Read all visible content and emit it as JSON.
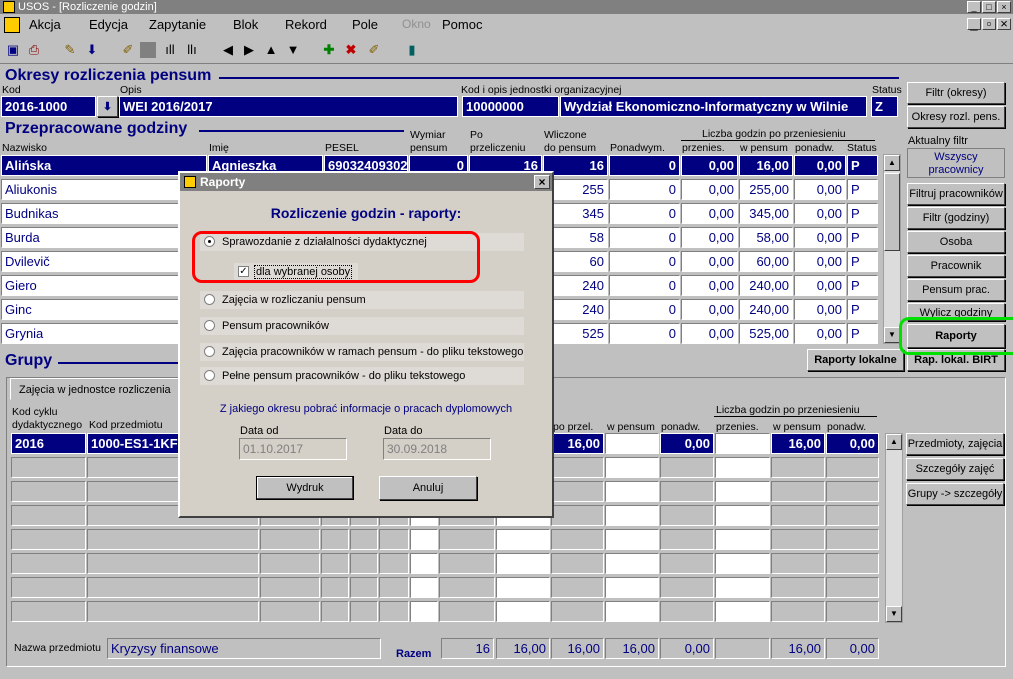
{
  "window": {
    "title": "USOS - [Rozliczenie godzin]"
  },
  "menu": [
    "Akcja",
    "Edycja",
    "Zapytanie",
    "Blok",
    "Rekord",
    "Pole",
    "Okno",
    "Pomoc"
  ],
  "okresy": {
    "title": "Okresy rozliczenia pensum",
    "kod_label": "Kod",
    "opis_label": "Opis",
    "kod_jedn_label": "Kod i opis jednostki organizacyjnej",
    "status_label": "Status",
    "kod": "2016-1000",
    "opis": "WEI 2016/2017",
    "kod_jedn": "10000000",
    "jedn_opis": "Wydział Ekonomiczno-Informatyczny w Wilnie",
    "status": "Z"
  },
  "godziny": {
    "title": "Przepracowane godziny",
    "headers": {
      "nazwisko": "Nazwisko",
      "imie": "Imię",
      "pesel": "PESEL",
      "wymiar1": "Wymiar",
      "wymiar2": "pensum",
      "po1": "Po",
      "po2": "przeliczeniu",
      "wl1": "Wliczone",
      "wl2": "do pensum",
      "ponad": "Ponadwym.",
      "liczba": "Liczba godzin po przeniesieniu",
      "przen": "przenies.",
      "wpensum": "w pensum",
      "ponadw": "ponadw.",
      "status": "Status"
    },
    "rows": [
      {
        "nazwisko": "Alińska",
        "imie": "Agnieszka",
        "pesel": "69032409302",
        "wymiar": "0",
        "po": "16",
        "wl": "16",
        "ponad": "0",
        "przen": "0,00",
        "wp": "16,00",
        "pw": "0,00",
        "st": "P"
      },
      {
        "nazwisko": "Aliukonis",
        "wl": "255",
        "ponad": "0",
        "przen": "0,00",
        "wp": "255,00",
        "pw": "0,00",
        "st": "P"
      },
      {
        "nazwisko": "Budnikas",
        "wl": "345",
        "ponad": "0",
        "przen": "0,00",
        "wp": "345,00",
        "pw": "0,00",
        "st": "P"
      },
      {
        "nazwisko": "Burda",
        "wl": "58",
        "ponad": "0",
        "przen": "0,00",
        "wp": "58,00",
        "pw": "0,00",
        "st": "P"
      },
      {
        "nazwisko": "Dvilevič",
        "wl": "60",
        "ponad": "0",
        "przen": "0,00",
        "wp": "60,00",
        "pw": "0,00",
        "st": "P"
      },
      {
        "nazwisko": "Giero",
        "wl": "240",
        "ponad": "0",
        "przen": "0,00",
        "wp": "240,00",
        "pw": "0,00",
        "st": "P"
      },
      {
        "nazwisko": "Ginc",
        "wl": "240",
        "ponad": "0",
        "przen": "0,00",
        "wp": "240,00",
        "pw": "0,00",
        "st": "P"
      },
      {
        "nazwisko": "Grynia",
        "wl": "525",
        "ponad": "0",
        "przen": "0,00",
        "wp": "525,00",
        "pw": "0,00",
        "st": "P"
      }
    ]
  },
  "side": {
    "filtr_okresy": "Filtr (okresy)",
    "okresy_rozl": "Okresy rozl. pens.",
    "aktualny": "Aktualny filtr",
    "wszyscy": "Wszyscy pracownicy",
    "filtruj": "Filtruj pracowników",
    "filtr_godz": "Filtr (godziny)",
    "osoba": "Osoba",
    "pracownik": "Pracownik",
    "pensum_prac": "Pensum prac.",
    "wylicz": "Wylicz godziny",
    "raporty": "Raporty",
    "raporty_lok": "Raporty lokalne",
    "rap_birt": "Rap. lokal. BIRT",
    "przedmioty": "Przedmioty, zajęcia",
    "szczegoly": "Szczegóły zajęć",
    "grupy_szcz": "Grupy -> szczegóły"
  },
  "grupy": {
    "title": "Grupy",
    "tab": "Zajęcia w jednostce rozliczenia",
    "h_kod_cyklu1": "Kod cyklu",
    "h_kod_cyklu2": "dydaktycznego",
    "h_kod_przedm": "Kod przedmiotu",
    "h_po_przel": "po przel.",
    "h_wpensum": "w pensum",
    "h_ponadw": "ponadw.",
    "h_liczba": "Liczba godzin po przeniesieniu",
    "h_przen": "przenies.",
    "h_wpensum2": "w pensum",
    "h_ponadw2": "ponadw.",
    "row": {
      "cykl": "2016",
      "przedm": "1000-ES1-1KFI",
      "po_przel": "16,00",
      "ponadw": "0,00",
      "wpensum2": "16,00",
      "ponadw2": "0,00"
    },
    "nazwa_label": "Nazwa przedmiotu",
    "nazwa": "Kryzysy finansowe",
    "razem": "Razem",
    "totals": [
      "16",
      "16,00",
      "16,00",
      "16,00",
      "0,00",
      "16,00",
      "0,00"
    ]
  },
  "dialog": {
    "title": "Raporty",
    "heading": "Rozliczenie godzin - raporty:",
    "options": [
      "Sprawozdanie z działalności dydaktycznej",
      "Zajęcia w rozliczaniu pensum",
      "Pensum pracowników",
      "Zajęcia pracowników w ramach pensum - do pliku tekstowego",
      "Pełne pensum pracowników - do pliku tekstowego"
    ],
    "checkbox": "dla wybranej osoby",
    "question": "Z jakiego okresu pobrać informacje o pracach dyplomowych",
    "data_od_label": "Data od",
    "data_od": "01.10.2017",
    "data_do_label": "Data do",
    "data_do": "30.09.2018",
    "wydruk": "Wydruk",
    "anuluj": "Anuluj"
  },
  "colors": {
    "navy": "#000080",
    "highlight_red": "#ff0000",
    "highlight_green": "#00e000"
  }
}
